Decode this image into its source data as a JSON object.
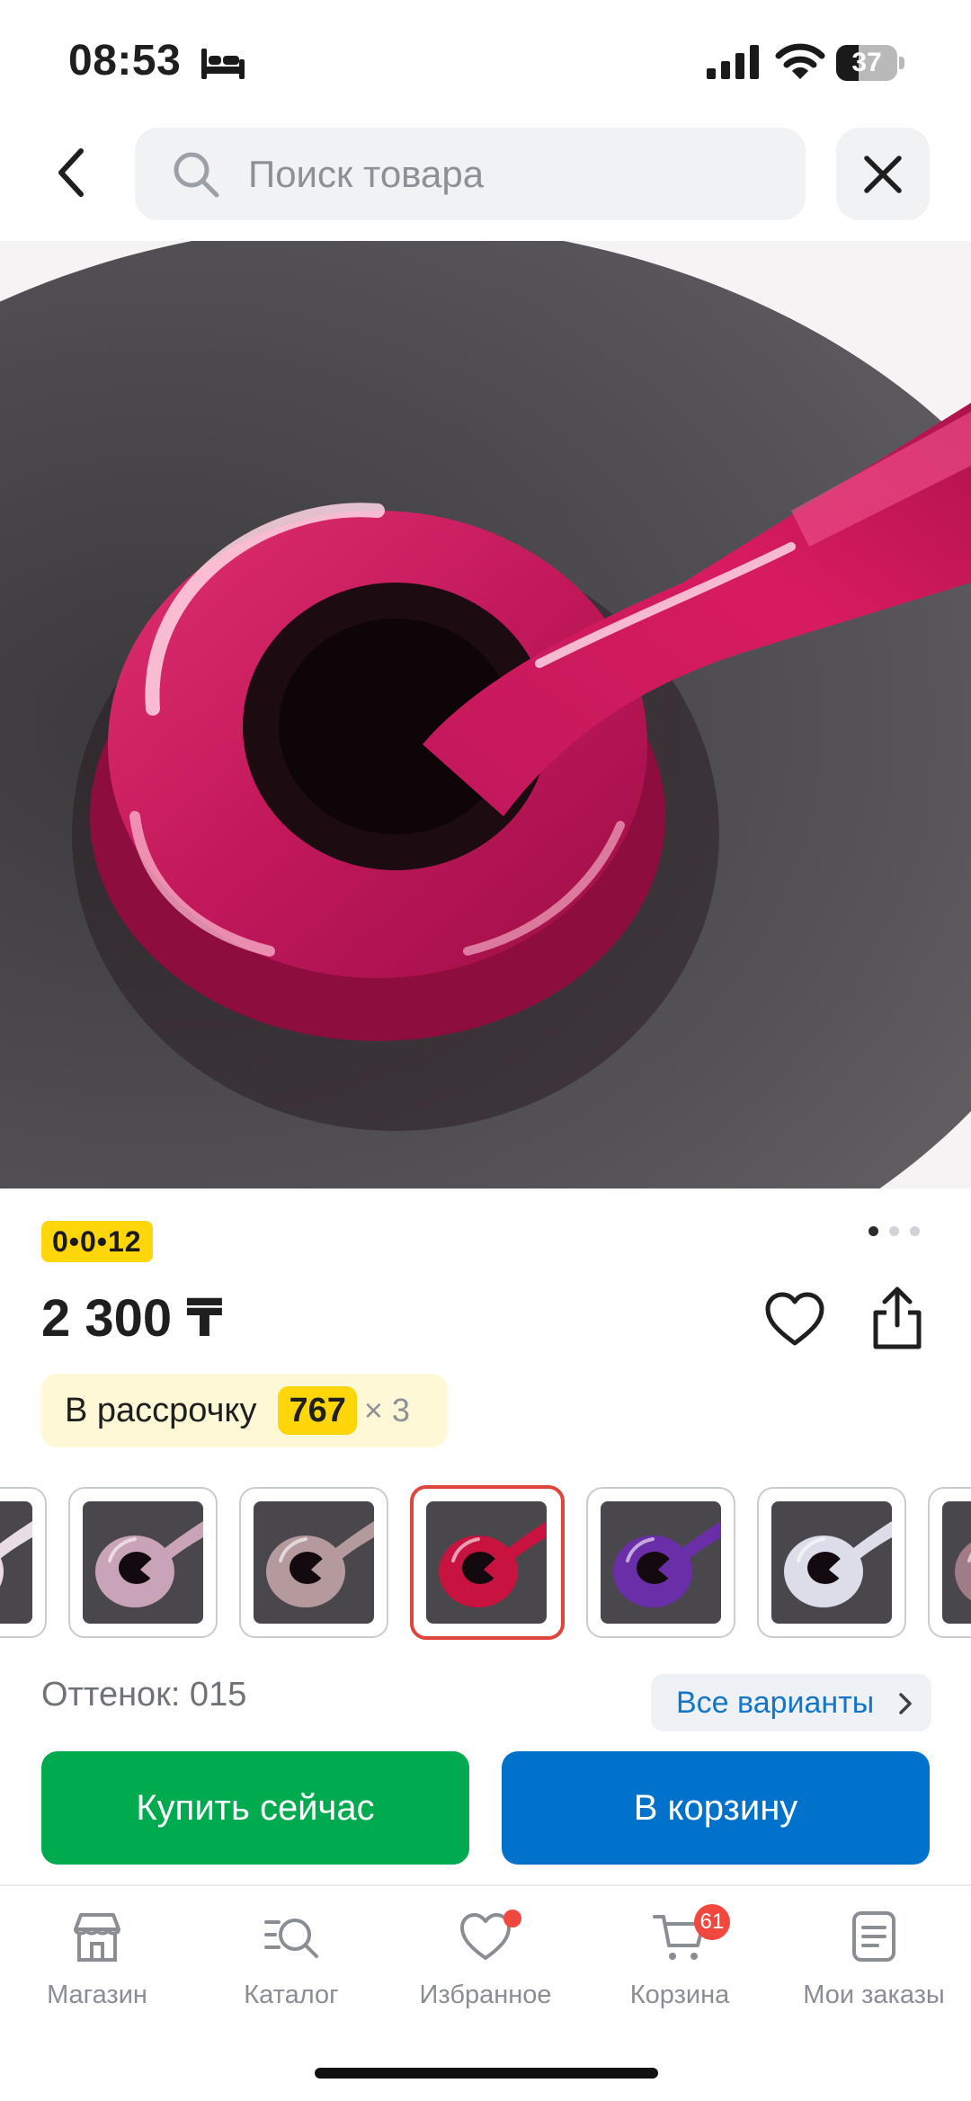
{
  "status_bar": {
    "time": "08:53",
    "battery_level": "37",
    "battery_fraction": 0.37,
    "icons": [
      "bed-icon",
      "signal-icon",
      "wifi-icon",
      "battery-icon"
    ]
  },
  "header": {
    "search_placeholder": "Поиск товара",
    "back_icon": "chevron-left-icon",
    "close_icon": "close-icon"
  },
  "product": {
    "image_subject": "nail-gel-polish-swatch",
    "image_colors": {
      "polish": "#c2185b",
      "background": "#4d4a4f"
    },
    "rating_badge": "0•0•12",
    "carousel": {
      "count": 3,
      "active_index": 0
    },
    "price": "2 300 ₸",
    "installment": {
      "label": "В рассрочку",
      "amount": "767",
      "multiplier": "× 3"
    },
    "shade_label": "Оттенок: 015",
    "all_variants_label": "Все варианты"
  },
  "variants": [
    {
      "color": "#e7dde3",
      "selected": false,
      "partial": true
    },
    {
      "color": "#c9a4b8",
      "selected": false
    },
    {
      "color": "#b49a9d",
      "selected": false
    },
    {
      "color": "#c8123f",
      "selected": true
    },
    {
      "color": "#6a2ea8",
      "selected": false
    },
    {
      "color": "#dcdde8",
      "selected": false
    },
    {
      "color": "#a07c88",
      "selected": false,
      "partial": true
    }
  ],
  "actions": {
    "buy_now": "Купить сейчас",
    "add_to_cart": "В корзину"
  },
  "bottom_nav": {
    "items": [
      {
        "label": "Магазин",
        "icon": "store-icon"
      },
      {
        "label": "Каталог",
        "icon": "catalog-search-icon"
      },
      {
        "label": "Избранное",
        "icon": "heart-icon",
        "dot": true
      },
      {
        "label": "Корзина",
        "icon": "cart-icon",
        "badge": "61"
      },
      {
        "label": "Мои заказы",
        "icon": "orders-icon"
      }
    ]
  },
  "colors": {
    "accent_green": "#00ab4f",
    "accent_blue": "#0072cc",
    "badge_yellow": "#ffd60a",
    "badge_red": "#f0483e",
    "selected_border": "#e0453b"
  }
}
